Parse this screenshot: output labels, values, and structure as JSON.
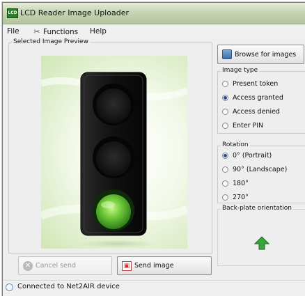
{
  "window": {
    "title": "LCD Reader Image Uploader",
    "app_icon_text": "LCD"
  },
  "menu": {
    "file": "File",
    "functions": "Functions",
    "help": "Help"
  },
  "preview": {
    "legend": "Selected Image Preview",
    "traffic_light_active": "green"
  },
  "buttons": {
    "cancel_send": "Cancel send",
    "send_image": "Send image",
    "browse": "Browse for images"
  },
  "image_type": {
    "legend": "Image type",
    "options": [
      "Present token",
      "Access granted",
      "Access denied",
      "Enter PIN"
    ],
    "selected": "Access granted"
  },
  "rotation": {
    "legend": "Rotation",
    "options": [
      "0° (Portrait)",
      "90° (Landscape)",
      "180°",
      "270°"
    ],
    "selected": "0° (Portrait)"
  },
  "backplate": {
    "legend": "Back-plate orientation",
    "arrow": "up-arrow-icon",
    "color": "#3aa33a"
  },
  "status": {
    "text": "Connected to Net2AIR device"
  },
  "colors": {
    "title_bar": "#c6d4b3",
    "accent_green": "#3aa33a",
    "selection_blue": "#1f4f93"
  }
}
